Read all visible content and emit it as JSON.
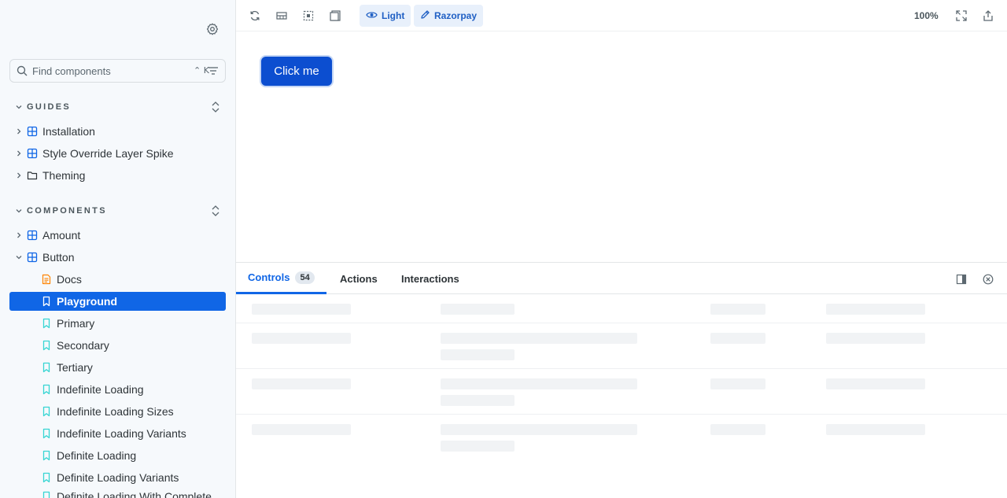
{
  "sidebar": {
    "search": {
      "placeholder": "Find components",
      "shortcut": "⌃ K"
    },
    "guides": {
      "label": "GUIDES",
      "items": [
        {
          "label": "Installation",
          "icon": "component-icon"
        },
        {
          "label": "Style Override Layer Spike",
          "icon": "component-icon"
        },
        {
          "label": "Theming",
          "icon": "folder-icon"
        }
      ]
    },
    "components": {
      "label": "COMPONENTS",
      "items": [
        {
          "label": "Amount",
          "icon": "component-icon"
        },
        {
          "label": "Button",
          "icon": "component-icon",
          "expanded": true
        }
      ],
      "button_children": [
        {
          "label": "Docs",
          "icon": "document-icon"
        },
        {
          "label": "Playground",
          "icon": "story-icon",
          "selected": true
        },
        {
          "label": "Primary",
          "icon": "story-icon"
        },
        {
          "label": "Secondary",
          "icon": "story-icon"
        },
        {
          "label": "Tertiary",
          "icon": "story-icon"
        },
        {
          "label": "Indefinite Loading",
          "icon": "story-icon"
        },
        {
          "label": "Indefinite Loading Sizes",
          "icon": "story-icon"
        },
        {
          "label": "Indefinite Loading Variants",
          "icon": "story-icon"
        },
        {
          "label": "Definite Loading",
          "icon": "story-icon"
        },
        {
          "label": "Definite Loading Variants",
          "icon": "story-icon"
        },
        {
          "label": "Definite Loading With Complete",
          "icon": "story-icon"
        }
      ]
    }
  },
  "toolbar": {
    "theme_label": "Light",
    "brand_label": "Razorpay",
    "zoom": "100%"
  },
  "canvas": {
    "demo_button_label": "Click me"
  },
  "panel": {
    "tabs": [
      {
        "label": "Controls",
        "badge": "54",
        "active": true
      },
      {
        "label": "Actions"
      },
      {
        "label": "Interactions"
      }
    ]
  },
  "colors": {
    "accent": "#1066e6",
    "demo_button": "#0c4ed0",
    "sidebar_bg": "#f6f9fc",
    "story_icon": "#37d5d3",
    "docs_icon": "#ff8300"
  }
}
